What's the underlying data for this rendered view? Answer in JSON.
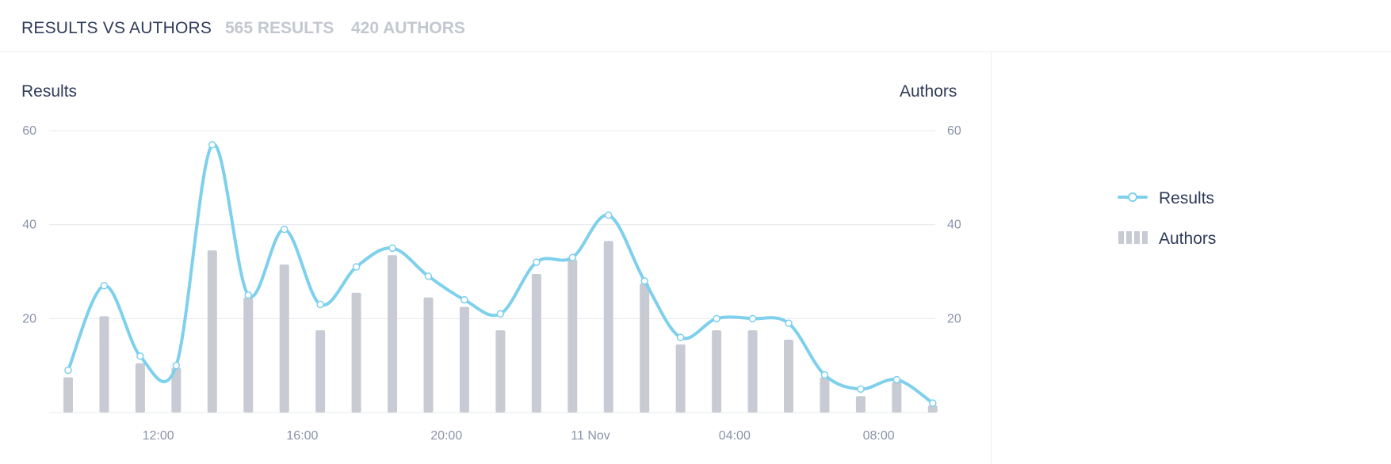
{
  "header": {
    "title": "RESULTS VS AUTHORS",
    "results_count": "565 RESULTS",
    "authors_count": "420 AUTHORS"
  },
  "colors": {
    "line": "#7ed0ec",
    "bar": "#c8cbd4",
    "grid": "#e6e8ec",
    "tick": "#8a93a8"
  },
  "chart_data": {
    "type": "line",
    "left_axis_title": "Results",
    "right_axis_title": "Authors",
    "ylim": [
      0,
      60
    ],
    "y_ticks": [
      "20",
      "40",
      "60"
    ],
    "x_ticks": [
      {
        "label": "12:00",
        "index": 2.5
      },
      {
        "label": "16:00",
        "index": 6.5
      },
      {
        "label": "20:00",
        "index": 10.5
      },
      {
        "label": "11 Nov",
        "index": 14.5
      },
      {
        "label": "04:00",
        "index": 18.5
      },
      {
        "label": "08:00",
        "index": 22.5
      }
    ],
    "series": [
      {
        "name": "Results",
        "type": "line",
        "values": [
          9,
          27,
          12,
          10,
          57,
          25,
          39,
          23,
          31,
          35,
          29,
          24,
          21,
          32,
          33,
          42,
          28,
          16,
          20,
          20,
          19,
          8,
          5,
          7,
          2
        ]
      },
      {
        "name": "Authors",
        "type": "bar",
        "values": [
          7.5,
          20.5,
          10.5,
          9.5,
          34.5,
          24.5,
          31.5,
          17.5,
          25.5,
          33.5,
          24.5,
          22.5,
          17.5,
          29.5,
          32.5,
          36.5,
          27.5,
          14.5,
          17.5,
          17.5,
          15.5,
          7.5,
          3.5,
          6.5,
          1.5
        ]
      }
    ],
    "grid": true,
    "legend": "right"
  },
  "legend": {
    "results_label": "Results",
    "authors_label": "Authors"
  }
}
